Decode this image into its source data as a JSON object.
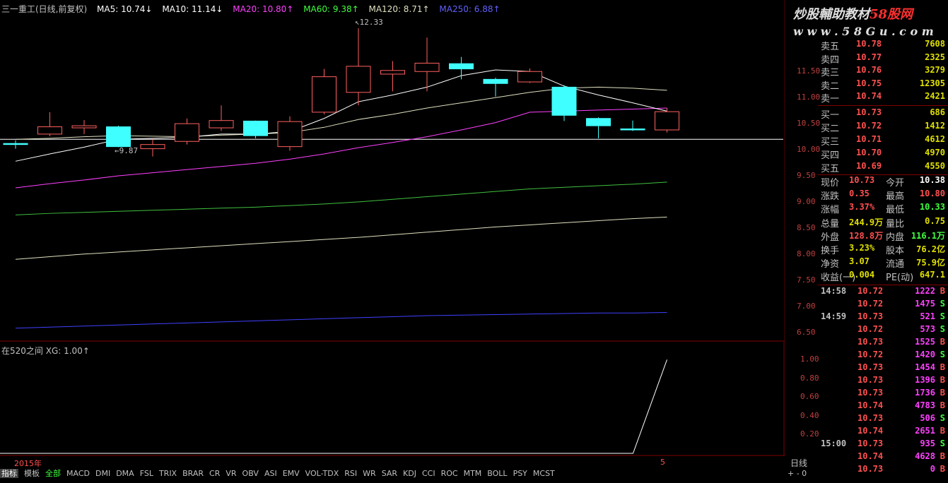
{
  "main_legend": {
    "title": "三一重工(日线,前复权)",
    "ma5": "MA5: 10.74↓",
    "ma10": "MA10: 11.14↓",
    "ma20": "MA20: 10.80↑",
    "ma60": "MA60: 9.38↑",
    "ma120": "MA120: 8.71↑",
    "ma250": "MA250: 6.88↑"
  },
  "colors": {
    "ma5": "#ffffff",
    "ma10": "#e0e0c0",
    "ma20": "#ff40ff",
    "ma60": "#40c040",
    "ma120": "#e0e0c0",
    "ma250": "#4040ff",
    "up": "#ff6060",
    "down": "#40ffff"
  },
  "annotations": {
    "high": "12.33",
    "low": "9.87"
  },
  "y_axis": [
    "11.50",
    "11.00",
    "10.50",
    "10.00",
    "9.50",
    "9.00",
    "8.50",
    "8.00",
    "7.50",
    "7.00",
    "6.50"
  ],
  "sub_legend": {
    "label": "在520之间",
    "xg": "XG: 1.00↑"
  },
  "sub_axis": [
    "1.00",
    "0.80",
    "0.60",
    "0.40",
    "0.20"
  ],
  "date_label": "2015年",
  "date_tick": "5",
  "period_label": "日线",
  "zoom_label": "+ - 0",
  "tabs": [
    "指标",
    "模板",
    "全部",
    "MACD",
    "DMI",
    "DMA",
    "FSL",
    "TRIX",
    "BRAR",
    "CR",
    "VR",
    "OBV",
    "ASI",
    "EMV",
    "VOL-TDX",
    "RSI",
    "WR",
    "SAR",
    "KDJ",
    "CCI",
    "ROC",
    "MTM",
    "BOLL",
    "PSY",
    "MCST"
  ],
  "watermark": {
    "line1": "炒股輔助教材58股网",
    "line2": "w w w . 5 8 G u . c o m"
  },
  "order_book": [
    {
      "label": "卖五",
      "price": "10.78",
      "vol": "7608"
    },
    {
      "label": "卖四",
      "price": "10.77",
      "vol": "2325"
    },
    {
      "label": "卖三",
      "price": "10.76",
      "vol": "3279"
    },
    {
      "label": "卖二",
      "price": "10.75",
      "vol": "12305"
    },
    {
      "label": "卖一",
      "price": "10.74",
      "vol": "2421"
    },
    {
      "label": "买一",
      "price": "10.73",
      "vol": "686"
    },
    {
      "label": "买二",
      "price": "10.72",
      "vol": "1412"
    },
    {
      "label": "买三",
      "price": "10.71",
      "vol": "4612"
    },
    {
      "label": "买四",
      "price": "10.70",
      "vol": "4970"
    },
    {
      "label": "买五",
      "price": "10.69",
      "vol": "4550"
    }
  ],
  "quote": [
    {
      "a": "现价",
      "b": "10.73",
      "bc": "#ff5050",
      "c": "今开",
      "d": "10.38",
      "dc": "#ffffff"
    },
    {
      "a": "涨跌",
      "b": "0.35",
      "bc": "#ff5050",
      "c": "最高",
      "d": "10.80",
      "dc": "#ff5050"
    },
    {
      "a": "涨幅",
      "b": "3.37%",
      "bc": "#ff5050",
      "c": "最低",
      "d": "10.33",
      "dc": "#40ff40"
    },
    {
      "a": "总量",
      "b": "244.9万",
      "bc": "#e0e000",
      "c": "量比",
      "d": "0.75",
      "dc": "#e0e000"
    },
    {
      "a": "外盘",
      "b": "128.8万",
      "bc": "#ff5050",
      "c": "内盘",
      "d": "116.1万",
      "dc": "#40ff40"
    },
    {
      "a": "换手",
      "b": "3.23%",
      "bc": "#e0e000",
      "c": "股本",
      "d": "76.2亿",
      "dc": "#e0e000"
    },
    {
      "a": "净资",
      "b": "3.07",
      "bc": "#e0e000",
      "c": "流通",
      "d": "75.9亿",
      "dc": "#e0e000"
    },
    {
      "a": "收益(一)",
      "b": "0.004",
      "bc": "#e0e000",
      "c": "PE(动)",
      "d": "647.1",
      "dc": "#e0e000"
    }
  ],
  "ticks": [
    {
      "t": "14:58",
      "p": "10.72",
      "v": "1222",
      "s": "B",
      "sc": "#ff5050"
    },
    {
      "t": "",
      "p": "10.72",
      "v": "1475",
      "s": "S",
      "sc": "#40ff40"
    },
    {
      "t": "14:59",
      "p": "10.73",
      "v": "521",
      "s": "S",
      "sc": "#40ff40"
    },
    {
      "t": "",
      "p": "10.72",
      "v": "573",
      "s": "S",
      "sc": "#40ff40"
    },
    {
      "t": "",
      "p": "10.73",
      "v": "1525",
      "s": "B",
      "sc": "#ff5050"
    },
    {
      "t": "",
      "p": "10.72",
      "v": "1420",
      "s": "S",
      "sc": "#40ff40"
    },
    {
      "t": "",
      "p": "10.73",
      "v": "1454",
      "s": "B",
      "sc": "#ff5050"
    },
    {
      "t": "",
      "p": "10.73",
      "v": "1396",
      "s": "B",
      "sc": "#ff5050"
    },
    {
      "t": "",
      "p": "10.73",
      "v": "1736",
      "s": "B",
      "sc": "#ff5050"
    },
    {
      "t": "",
      "p": "10.74",
      "v": "4783",
      "s": "B",
      "sc": "#ff5050"
    },
    {
      "t": "",
      "p": "10.73",
      "v": "506",
      "s": "S",
      "sc": "#40ff40"
    },
    {
      "t": "",
      "p": "10.74",
      "v": "2651",
      "s": "B",
      "sc": "#ff5050"
    },
    {
      "t": "15:00",
      "p": "10.73",
      "v": "935",
      "s": "S",
      "sc": "#40ff40"
    },
    {
      "t": "",
      "p": "10.74",
      "v": "4628",
      "s": "B",
      "sc": "#ff5050"
    },
    {
      "t": "",
      "p": "10.73",
      "v": "0",
      "s": "B",
      "sc": "#ff5050"
    }
  ],
  "chart_data": {
    "type": "candlestick",
    "candles": [
      {
        "o": 10.12,
        "h": 10.18,
        "l": 10.02,
        "c": 10.1
      },
      {
        "o": 10.3,
        "h": 10.72,
        "l": 10.26,
        "c": 10.44
      },
      {
        "o": 10.42,
        "h": 10.57,
        "l": 10.3,
        "c": 10.46
      },
      {
        "o": 10.44,
        "h": 10.46,
        "l": 10.05,
        "c": 10.06
      },
      {
        "o": 10.02,
        "h": 10.2,
        "l": 9.87,
        "c": 10.1
      },
      {
        "o": 10.16,
        "h": 10.6,
        "l": 10.1,
        "c": 10.5
      },
      {
        "o": 10.42,
        "h": 10.85,
        "l": 10.36,
        "c": 10.56
      },
      {
        "o": 10.55,
        "h": 10.56,
        "l": 10.22,
        "c": 10.27
      },
      {
        "o": 10.06,
        "h": 10.64,
        "l": 9.98,
        "c": 10.54
      },
      {
        "o": 10.72,
        "h": 11.55,
        "l": 10.68,
        "c": 11.4
      },
      {
        "o": 11.1,
        "h": 12.33,
        "l": 10.85,
        "c": 11.6
      },
      {
        "o": 11.45,
        "h": 11.7,
        "l": 11.12,
        "c": 11.52
      },
      {
        "o": 11.5,
        "h": 12.15,
        "l": 11.12,
        "c": 11.66
      },
      {
        "o": 11.65,
        "h": 11.78,
        "l": 11.35,
        "c": 11.55
      },
      {
        "o": 11.35,
        "h": 11.38,
        "l": 11.02,
        "c": 11.27
      },
      {
        "o": 11.3,
        "h": 11.56,
        "l": 11.28,
        "c": 11.5
      },
      {
        "o": 11.2,
        "h": 11.24,
        "l": 10.55,
        "c": 10.66
      },
      {
        "o": 10.6,
        "h": 10.62,
        "l": 10.22,
        "c": 10.46
      },
      {
        "o": 10.4,
        "h": 10.56,
        "l": 10.36,
        "c": 10.38
      },
      {
        "o": 10.38,
        "h": 10.8,
        "l": 10.33,
        "c": 10.73
      }
    ],
    "ma5": [
      9.78,
      9.92,
      10.05,
      10.2,
      10.22,
      10.24,
      10.3,
      10.3,
      10.35,
      10.6,
      10.92,
      11.05,
      11.2,
      11.42,
      11.53,
      11.5,
      11.22,
      11.05,
      10.9,
      10.74
    ],
    "ma10": [
      10.2,
      10.22,
      10.25,
      10.27,
      10.26,
      10.25,
      10.28,
      10.3,
      10.33,
      10.43,
      10.58,
      10.68,
      10.8,
      10.9,
      11.0,
      11.1,
      11.18,
      11.2,
      11.18,
      11.14
    ],
    "ma20": [
      9.27,
      9.35,
      9.42,
      9.5,
      9.56,
      9.62,
      9.68,
      9.74,
      9.82,
      9.92,
      10.04,
      10.14,
      10.25,
      10.38,
      10.52,
      10.72,
      10.74,
      10.76,
      10.78,
      10.8
    ],
    "ma60": [
      8.75,
      8.78,
      8.8,
      8.82,
      8.84,
      8.86,
      8.88,
      8.9,
      8.93,
      8.96,
      9.0,
      9.05,
      9.1,
      9.15,
      9.2,
      9.25,
      9.28,
      9.31,
      9.34,
      9.38
    ],
    "ma120": [
      7.9,
      7.95,
      8.0,
      8.04,
      8.08,
      8.12,
      8.16,
      8.2,
      8.24,
      8.28,
      8.32,
      8.37,
      8.42,
      8.47,
      8.52,
      8.56,
      8.6,
      8.64,
      8.68,
      8.71
    ],
    "ma250": [
      6.58,
      6.6,
      6.62,
      6.64,
      6.66,
      6.68,
      6.7,
      6.72,
      6.74,
      6.76,
      6.78,
      6.8,
      6.82,
      6.83,
      6.84,
      6.85,
      6.86,
      6.87,
      6.87,
      6.88
    ],
    "reference_line": 10.2,
    "ylim": [
      6.4,
      12.6
    ],
    "xg": [
      0,
      0,
      0,
      0,
      0,
      0,
      0,
      0,
      0,
      0,
      0,
      0,
      0,
      0,
      0,
      0,
      0,
      0,
      0,
      1
    ],
    "xg_ylim": [
      0,
      1.1
    ]
  }
}
